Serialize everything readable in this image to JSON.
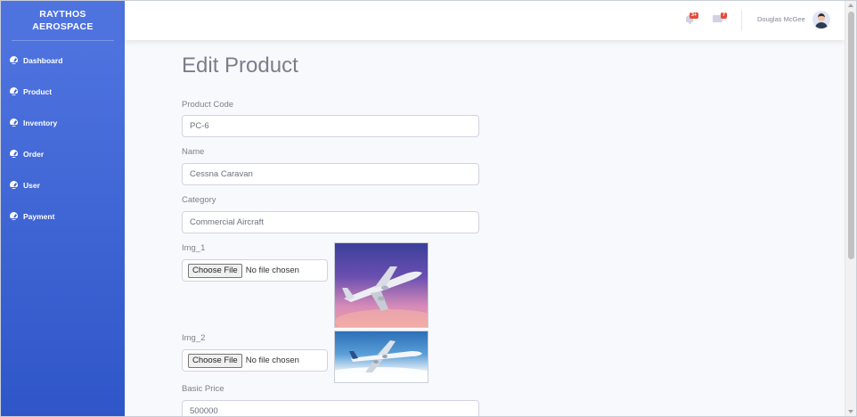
{
  "brand": {
    "line1": "RAYTHOS",
    "line2": "AEROSPACE"
  },
  "sidebar": {
    "items": [
      {
        "label": "Dashboard"
      },
      {
        "label": "Product"
      },
      {
        "label": "Inventory"
      },
      {
        "label": "Order"
      },
      {
        "label": "User"
      },
      {
        "label": "Payment"
      }
    ]
  },
  "topbar": {
    "alerts_badge": "3+",
    "messages_badge": "7",
    "username": "Douglas McGee"
  },
  "page": {
    "title": "Edit Product"
  },
  "form": {
    "product_code": {
      "label": "Product Code",
      "value": "PC-6"
    },
    "name": {
      "label": "Name",
      "value": "Cessna Caravan"
    },
    "category": {
      "label": "Category",
      "value": "Commercial Aircraft"
    },
    "img1": {
      "label": "Img_1",
      "button": "Choose File",
      "status": "No file chosen"
    },
    "img2": {
      "label": "Img_2",
      "button": "Choose File",
      "status": "No file chosen"
    },
    "basic_price": {
      "label": "Basic  Price",
      "value": "500000"
    }
  },
  "colors": {
    "sidebar": "#4e73df",
    "badge": "#e74a3b"
  }
}
